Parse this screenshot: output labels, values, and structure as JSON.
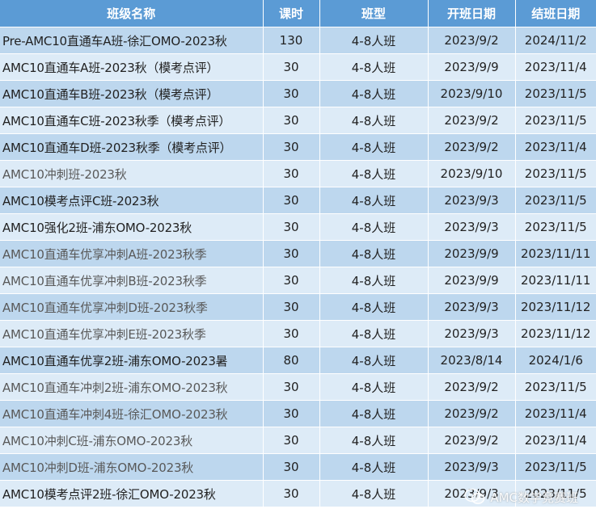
{
  "table": {
    "headers": [
      "班级名称",
      "课时",
      "班型",
      "开班日期",
      "结班日期"
    ],
    "rows": [
      [
        "Pre-AMC10直通车A班-徐汇OMO-2023秋",
        "130",
        "4-8人班",
        "2023/9/2",
        "2024/11/2"
      ],
      [
        "AMC10直通车A班-2023秋（模考点评）",
        "30",
        "4-8人班",
        "2023/9/9",
        "2023/11/4"
      ],
      [
        "AMC10直通车B班-2023秋（模考点评）",
        "30",
        "4-8人班",
        "2023/9/10",
        "2023/11/5"
      ],
      [
        "AMC10直通车C班-2023秋季（模考点评）",
        "30",
        "4-8人班",
        "2023/9/2",
        "2023/11/5"
      ],
      [
        "AMC10直通车D班-2023秋季（模考点评）",
        "30",
        "4-8人班",
        "2023/9/2",
        "2023/11/4"
      ],
      [
        "AMC10冲刺班-2023秋",
        "30",
        "4-8人班",
        "2023/9/10",
        "2023/11/5"
      ],
      [
        "AMC10模考点评C班-2023秋",
        "30",
        "4-8人班",
        "2023/9/3",
        "2023/11/5"
      ],
      [
        "AMC10强化2班-浦东OMO-2023秋",
        "30",
        "4-8人班",
        "2023/9/3",
        "2023/11/5"
      ],
      [
        "AMC10直通车优享冲刺A班-2023秋季",
        "30",
        "4-8人班",
        "2023/9/9",
        "2023/11/11"
      ],
      [
        "AMC10直通车优享冲刺B班-2023秋季",
        "30",
        "4-8人班",
        "2023/9/9",
        "2023/11/11"
      ],
      [
        "AMC10直通车优享冲刺D班-2023秋季",
        "30",
        "4-8人班",
        "2023/9/3",
        "2023/11/12"
      ],
      [
        "AMC10直通车优享冲刺E班-2023秋季",
        "30",
        "4-8人班",
        "2023/9/3",
        "2023/11/12"
      ],
      [
        "AMC10直通车优享2班-浦东OMO-2023暑",
        "80",
        "4-8人班",
        "2023/8/14",
        "2024/1/6"
      ],
      [
        "AMC10直通车冲刺2班-浦东OMO-2023秋",
        "30",
        "4-8人班",
        "2023/9/2",
        "2023/11/5"
      ],
      [
        "AMC10直通车冲刺4班-徐汇OMO-2023秋",
        "30",
        "4-8人班",
        "2023/9/2",
        "2023/11/4"
      ],
      [
        "AMC10冲刺C班-浦东OMO-2023秋",
        "30",
        "4-8人班",
        "2023/9/2",
        "2023/11/4"
      ],
      [
        "AMC10冲刺D班-浦东OMO-2023秋",
        "30",
        "4-8人班",
        "2023/9/3",
        "2023/11/5"
      ],
      [
        "AMC10模考点评2班-徐汇OMO-2023秋",
        "30",
        "4-8人班",
        "2023/9/3",
        "2023/11/5"
      ]
    ],
    "muted_rows": [
      5,
      8,
      9,
      10,
      11,
      13,
      14,
      15,
      16
    ]
  },
  "colors": {
    "header_bg": "#5b9bd5",
    "row_dark": "#bdd7ee",
    "row_light": "#ddebf7"
  },
  "watermark": {
    "icon": "wechat-icon",
    "text": "AMC数学竞赛班"
  }
}
